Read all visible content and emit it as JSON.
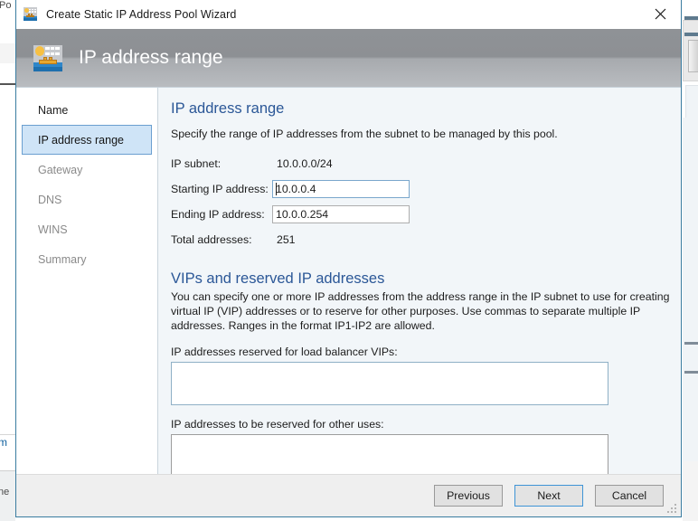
{
  "window": {
    "title": "Create Static IP Address Pool Wizard",
    "title_icon": "ip-pool-icon",
    "close_icon": "close-icon"
  },
  "banner": {
    "title": "IP address range",
    "icon": "ip-pool-icon"
  },
  "sidebar": {
    "items": [
      {
        "label": "Name",
        "state": "done"
      },
      {
        "label": "IP address range",
        "state": "active"
      },
      {
        "label": "Gateway",
        "state": "pending"
      },
      {
        "label": "DNS",
        "state": "pending"
      },
      {
        "label": "WINS",
        "state": "pending"
      },
      {
        "label": "Summary",
        "state": "pending"
      }
    ]
  },
  "main": {
    "section1": {
      "heading": "IP address range",
      "description": "Specify the range of IP addresses from the subnet to be managed by this pool.",
      "fields": {
        "subnet_label": "IP subnet:",
        "subnet_value": "10.0.0.0/24",
        "start_label": "Starting IP address:",
        "start_value": "10.0.0.4",
        "end_label": "Ending IP address:",
        "end_value": "10.0.0.254",
        "total_label": "Total addresses:",
        "total_value": "251"
      }
    },
    "section2": {
      "heading": "VIPs and reserved IP addresses",
      "description": "You can specify one or more IP addresses from the address range in the IP subnet to use for creating virtual IP (VIP) addresses or to reserve for other purposes. Use commas to separate multiple IP addresses. Ranges in the format IP1-IP2 are allowed.",
      "vip_label": "IP addresses reserved for load balancer VIPs:",
      "vip_value": "",
      "other_label": "IP addresses to be reserved for other uses:",
      "other_value": ""
    }
  },
  "footer": {
    "previous_label": "Previous",
    "next_label": "Next",
    "cancel_label": "Cancel"
  },
  "background": {
    "text_top": "Po",
    "text_mid": "m",
    "text_bottom": "ne"
  },
  "colors": {
    "accent_heading": "#2b5797",
    "window_border": "#3a7ca0",
    "selected_nav_bg": "#cfe4f7",
    "selected_nav_border": "#6b9fd0",
    "content_bg": "#f2f6f9",
    "banner_gradient_top": "#8f9296",
    "banner_gradient_bottom": "#b9bcc0"
  }
}
